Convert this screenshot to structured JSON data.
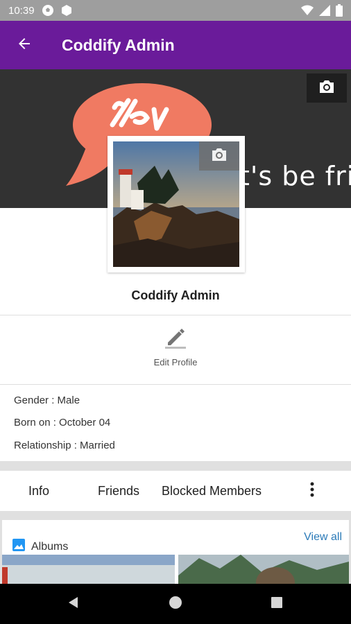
{
  "status_bar": {
    "time": "10:39",
    "icons": [
      "soccer-ball-icon",
      "hexagon-icon",
      "wifi-icon",
      "signal-icon",
      "battery-icon"
    ]
  },
  "app_bar": {
    "title": "Coddify Admin",
    "back_icon": "arrow-left-icon",
    "background": "#6a1b9a"
  },
  "cover": {
    "banner_text": "t's be fri",
    "camera_icon": "camera-icon"
  },
  "profile": {
    "name": "Coddify Admin",
    "camera_icon": "camera-icon"
  },
  "edit_profile": {
    "label": "Edit Profile",
    "icon": "pencil-icon"
  },
  "details": {
    "gender": "Gender : Male",
    "born": "Born on : October 04",
    "relationship": "Relationship : Married"
  },
  "tabs": [
    {
      "label": "Info"
    },
    {
      "label": "Friends"
    },
    {
      "label": "Blocked Members"
    }
  ],
  "more_icon": "more-vertical-icon",
  "albums": {
    "title": "Albums",
    "view_all": "View all",
    "icon": "image-icon",
    "link_color": "#2a7ab8"
  },
  "nav_bar": {
    "icons": [
      "back-triangle-icon",
      "home-circle-icon",
      "recents-square-icon"
    ]
  }
}
